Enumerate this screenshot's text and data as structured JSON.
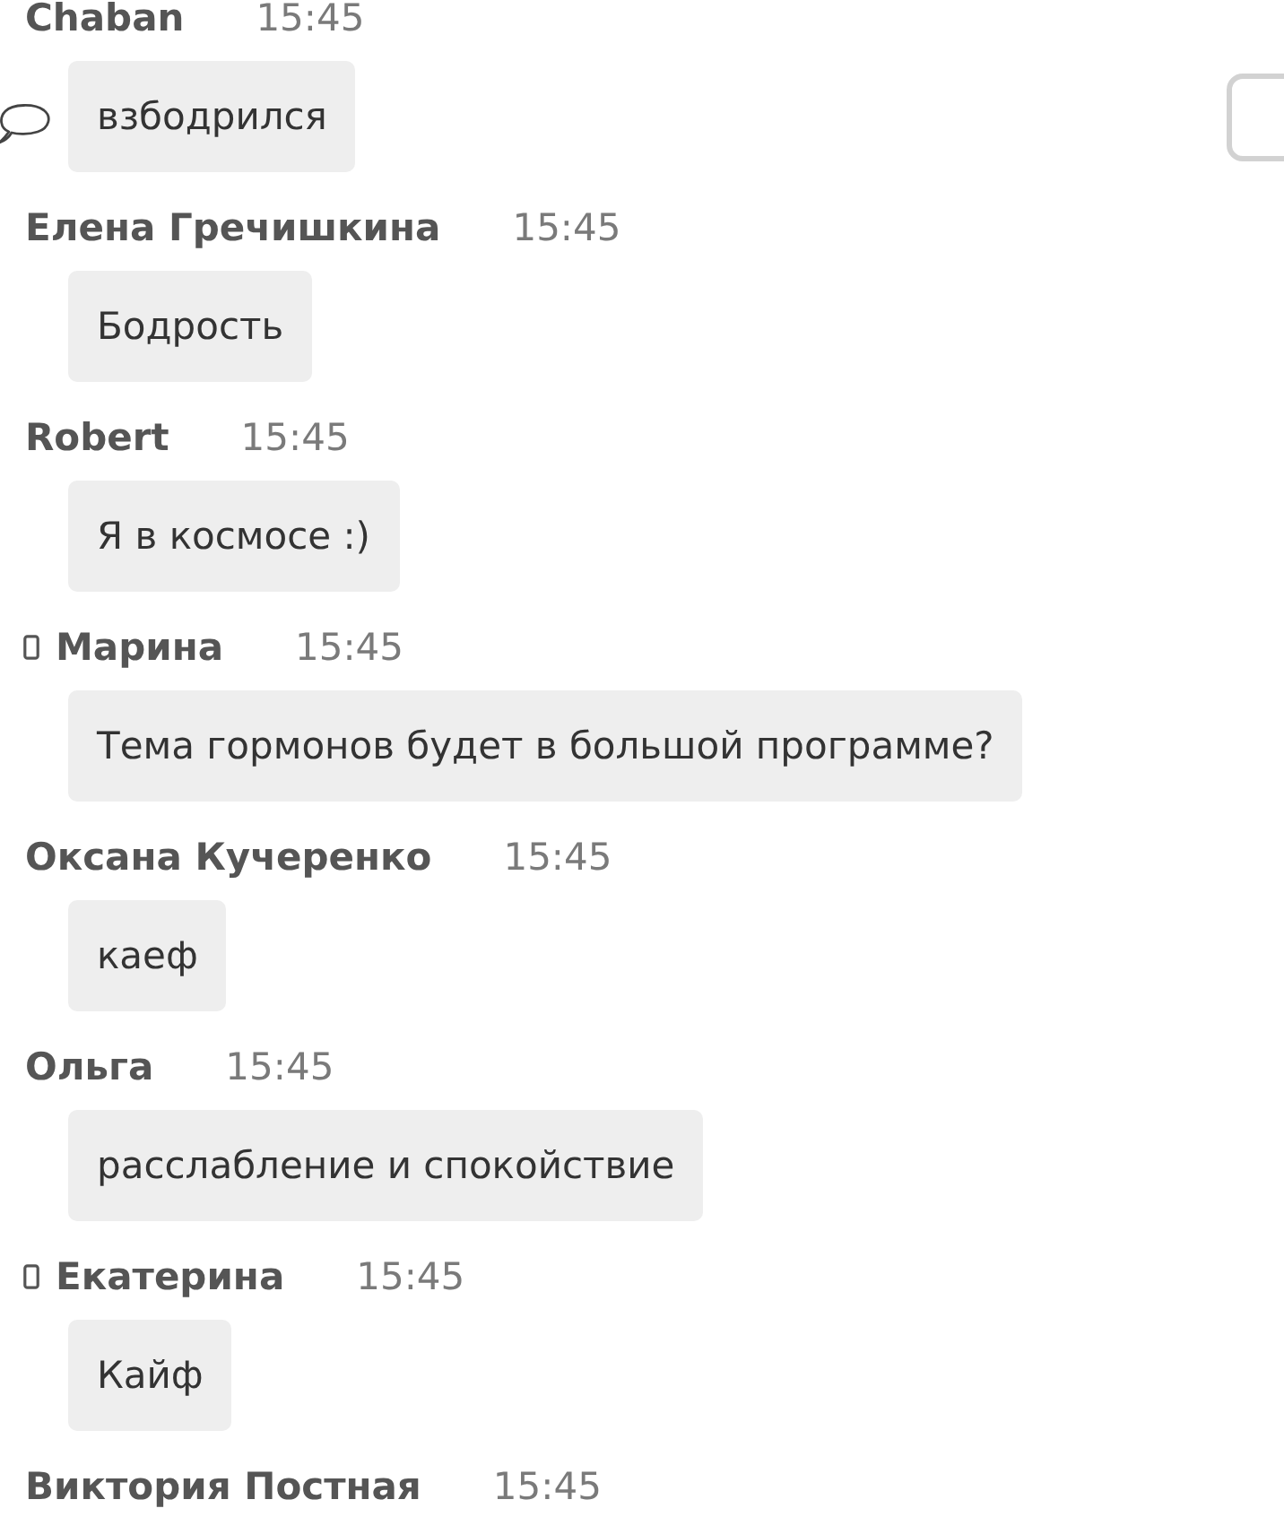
{
  "messages": [
    {
      "author": "Chaban",
      "time": "15:45",
      "text": "взбодрился",
      "mobile": false,
      "hovered": true,
      "checked": false
    },
    {
      "author": "Елена Гречишкина",
      "time": "15:45",
      "text": "Бодрость",
      "mobile": false,
      "hovered": false,
      "checked": false
    },
    {
      "author": "Robert",
      "time": "15:45",
      "text": "Я в космосе :)",
      "mobile": false,
      "hovered": false,
      "checked": false
    },
    {
      "author": "Марина",
      "time": "15:45",
      "text": "Тема гормонов будет в большой программе?",
      "mobile": true,
      "hovered": false,
      "checked": false
    },
    {
      "author": "Оксана Кучеренко",
      "time": "15:45",
      "text": "каеф",
      "mobile": false,
      "hovered": false,
      "checked": false
    },
    {
      "author": "Ольга",
      "time": "15:45",
      "text": "расслабление и спокойствие",
      "mobile": false,
      "hovered": false,
      "checked": false
    },
    {
      "author": "Екатерина",
      "time": "15:45",
      "text": "Кайф",
      "mobile": true,
      "hovered": false,
      "checked": false
    },
    {
      "author": "Виктория Постная",
      "time": "15:45",
      "mobile": false,
      "hovered": false,
      "checked": false
    }
  ]
}
